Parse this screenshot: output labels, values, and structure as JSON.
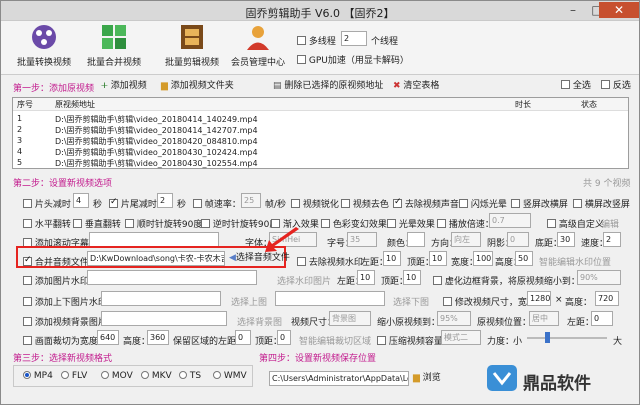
{
  "window": {
    "title": "固乔剪辑助手 V6.0  【固乔2】"
  },
  "toolbar": {
    "batch_convert": "批量转换视频",
    "batch_merge": "批量合并视频",
    "batch_edit": "批量剪辑视频",
    "member": "会员管理中心",
    "multithread": "多线程",
    "threads_value": "2",
    "threads_unit": "个线程",
    "gpu": "GPU加速（用显卡解码）"
  },
  "step1": {
    "label": "第一步：添加原视频",
    "add_video": "添加视频",
    "add_folder": "添加视频文件夹",
    "delete_selected": "删除已选择的原视频地址",
    "clear_table": "清空表格",
    "select_all": "全选",
    "invert": "反选"
  },
  "table": {
    "headers": [
      "序号",
      "原视频地址",
      "时长",
      "状态"
    ],
    "rows": [
      {
        "no": "1",
        "path": "D:\\固乔剪辑助手\\剪辑\\video_20180414_140249.mp4"
      },
      {
        "no": "2",
        "path": "D:\\固乔剪辑助手\\剪辑\\video_20180414_142707.mp4"
      },
      {
        "no": "3",
        "path": "D:\\固乔剪辑助手\\剪辑\\video_20180420_084810.mp4"
      },
      {
        "no": "4",
        "path": "D:\\固乔剪辑助手\\剪辑\\video_20180430_102424.mp4"
      },
      {
        "no": "5",
        "path": "D:\\固乔剪辑助手\\剪辑\\video_20180430_102554.mp4"
      }
    ]
  },
  "step2": {
    "label": "第二步：设置新视频选项",
    "count": "共 9 个视频"
  },
  "opts": {
    "head_cut": "片头减时",
    "head_val": "4",
    "sec1": "秒",
    "tail_cut": "片尾减时",
    "tail_val": "2",
    "sec2": "秒",
    "framerate": "帧速率：",
    "framerate_val": "25",
    "fps": "帧/秒",
    "video_sharpen": "视频锐化",
    "video_color": "视频去色",
    "remove_audio": "去除视频声音",
    "flash_white": "闪烁光晕",
    "vertical_blur": "竖屏改横屏",
    "horizontal_blur": "横屏改竖屏",
    "h_flip": "水平翻转",
    "v_flip": "垂直翻转",
    "cw90": "顺时针旋转90度",
    "ccw90": "逆时针旋转90度",
    "fade_in": "渐入效果",
    "color_change": "色彩变幻效果",
    "light_effect": "光晕效果",
    "speed": "播放倍速：",
    "speed_val": "0.7",
    "adv_custom": "高级自定义",
    "edit": "编辑",
    "scroll_sub": "添加滚动字幕：",
    "font": "字体：",
    "font_val": "SimHei",
    "size": "字号：",
    "size_val": "35",
    "color": "颜色：",
    "direction": "方向：",
    "direction_val": "向左",
    "shadow": "阴影：",
    "shadow_val": "0",
    "bottom": "底距：",
    "bottom_val": "30",
    "speed2": "速度：",
    "speed2_val": "2",
    "merge_audio": "合并音频文件：",
    "audio_path": "D:\\KwDownload\\song\\卡农-卡农木吉他描",
    "choose_audio": "选择音频文件",
    "remove_watermark": "去除视频水印",
    "left": "左距：",
    "left_val": "10",
    "top": "顶距：",
    "top_val": "10",
    "width": "宽度：",
    "width_val": "100",
    "height": "高度：",
    "height_val": "50",
    "smart_wm": "智能编辑水印位置",
    "add_pic": "添加图片水印：",
    "choose_wm": "选择水印图片",
    "left2": "左距：",
    "left2_val": "10",
    "top2": "顶距：",
    "top2_val": "10",
    "blur_bg": "虚化边框背景，将原视频缩小到：",
    "blur_val": "90%",
    "add_head_tail": "添加上下图片水印：",
    "choose_top": "选择上图",
    "choose_bottom": "选择下图",
    "modify_size": "修改视频尺寸，宽度：",
    "w_val": "1280",
    "x": "×",
    "height2": "高度：",
    "h_val": "720",
    "bg_pic": "添加视频背景图片：",
    "choose_bg": "选择背景图",
    "video_size": "视频尺寸：",
    "bg_val": "背景图",
    "shrink": "缩小原视频到：",
    "shrink_val": "95%",
    "position": "原视频位置：",
    "pos_val": "居中",
    "left3": "左距：",
    "left3_val": "0",
    "crop": "画面裁切为宽度：",
    "crop_w": "640",
    "crop_h_label": "高度：",
    "crop_h": "360",
    "keep_left": "保留区域的左距：",
    "keep_left_val": "0",
    "keep_top": "顶距：",
    "keep_top_val": "0",
    "smart_crop": "智能编辑裁切区域",
    "compress": "压缩视频容量",
    "mode": "模式二",
    "strength": "力度：",
    "small": "小",
    "big": "大"
  },
  "step3": {
    "label": "第三步：选择新视频格式",
    "formats": [
      "MP4",
      "FLV",
      "MOV",
      "MKV",
      "TS",
      "WMV"
    ]
  },
  "step4": {
    "label": "第四步：设置新视频保存位置",
    "path": "C:\\Users\\Administrator\\AppData\\Lo",
    "browse": "浏览"
  },
  "brand": {
    "name": "鼎品软件"
  }
}
